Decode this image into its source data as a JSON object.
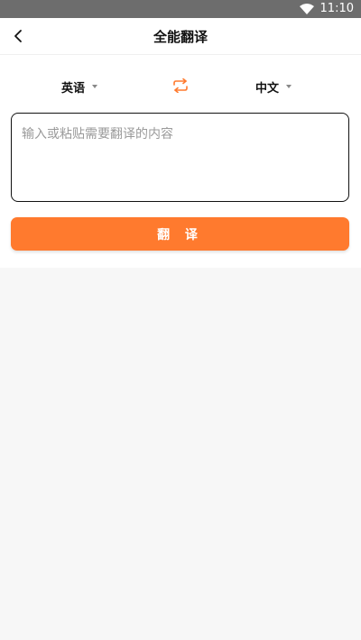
{
  "status_bar": {
    "time": "11:10",
    "wifi_icon": "wifi-icon"
  },
  "header": {
    "back_icon": "chevron-left-icon",
    "title": "全能翻译"
  },
  "language_bar": {
    "source_language": "英语",
    "target_language": "中文",
    "swap_icon": "swap-arrows-icon",
    "dropdown_icon": "caret-down-icon"
  },
  "input": {
    "value": "",
    "placeholder": "输入或粘贴需要翻译的内容"
  },
  "translate_button": {
    "label": "翻 译"
  },
  "colors": {
    "accent": "#ff7a2e",
    "status_bar": "#6d6d6d",
    "page_background": "#f7f7f7"
  }
}
